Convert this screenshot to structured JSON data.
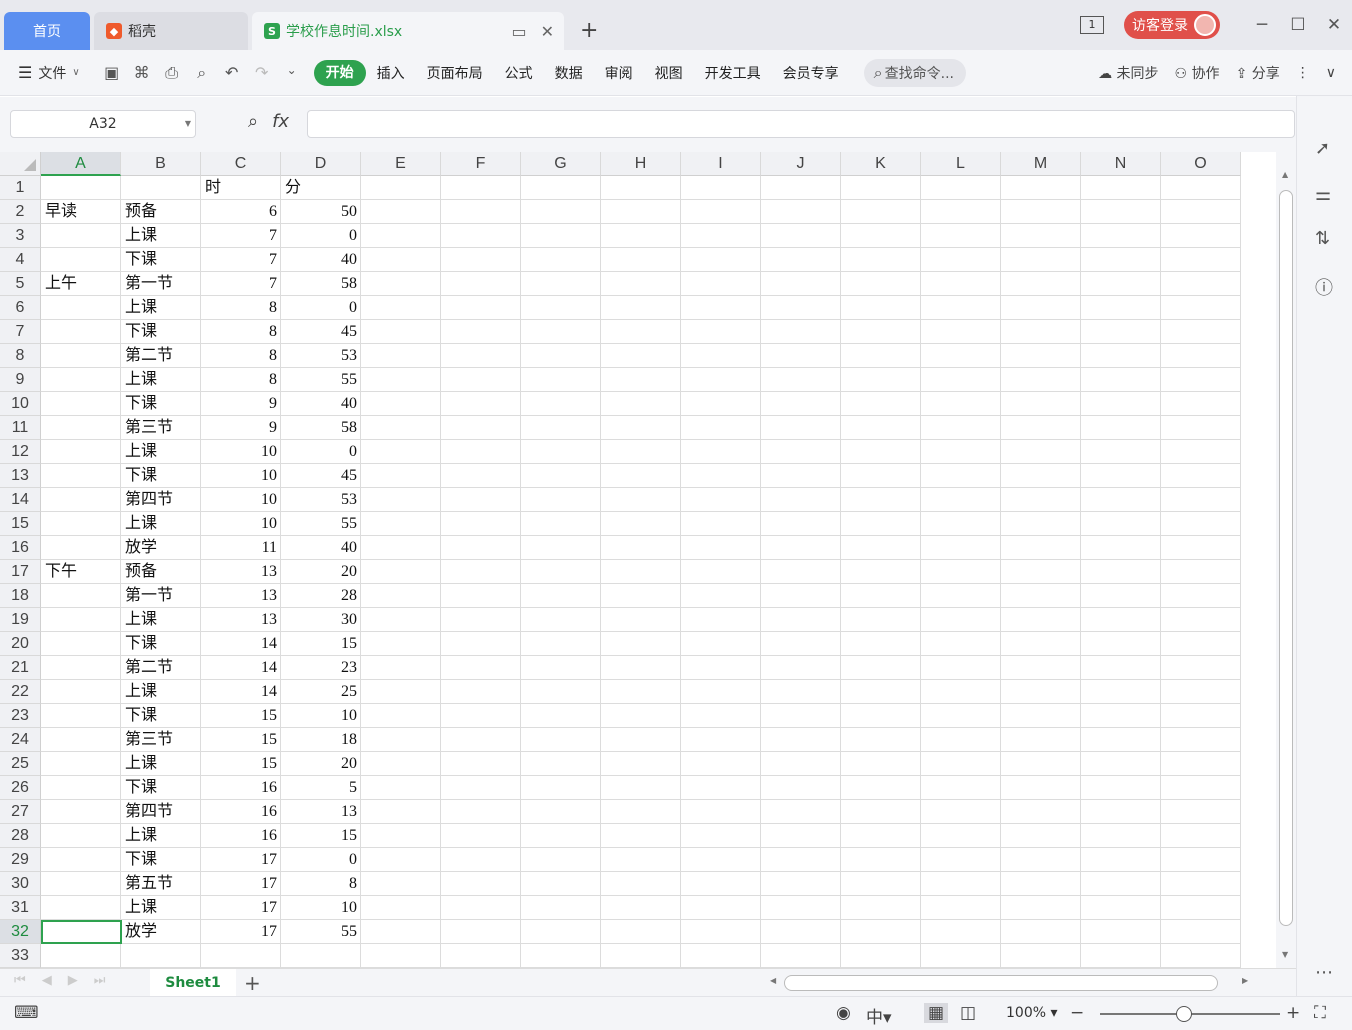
{
  "tabs": {
    "home": "首页",
    "daoke": "稻壳",
    "file": "学校作息时间.xlsx"
  },
  "titlebar": {
    "page_count": "1",
    "login": "访客登录"
  },
  "toolbar": {
    "file_menu": "文件",
    "menus": [
      "开始",
      "插入",
      "页面布局",
      "公式",
      "数据",
      "审阅",
      "视图",
      "开发工具",
      "会员专享"
    ],
    "search_placeholder": "查找命令...",
    "sync": "未同步",
    "collab": "协作",
    "share": "分享"
  },
  "formula": {
    "namebox": "A32",
    "fx": "fx",
    "value": ""
  },
  "columns": [
    "A",
    "B",
    "C",
    "D",
    "E",
    "F",
    "G",
    "H",
    "I",
    "J",
    "K",
    "L",
    "M",
    "N",
    "O"
  ],
  "rows": [
    [
      "",
      "",
      "时",
      "分"
    ],
    [
      "早读",
      "预备",
      "6",
      "50"
    ],
    [
      "",
      "上课",
      "7",
      "0"
    ],
    [
      "",
      "下课",
      "7",
      "40"
    ],
    [
      "上午",
      "第一节",
      "7",
      "58"
    ],
    [
      "",
      "上课",
      "8",
      "0"
    ],
    [
      "",
      "下课",
      "8",
      "45"
    ],
    [
      "",
      "第二节",
      "8",
      "53"
    ],
    [
      "",
      "上课",
      "8",
      "55"
    ],
    [
      "",
      "下课",
      "9",
      "40"
    ],
    [
      "",
      "第三节",
      "9",
      "58"
    ],
    [
      "",
      "上课",
      "10",
      "0"
    ],
    [
      "",
      "下课",
      "10",
      "45"
    ],
    [
      "",
      "第四节",
      "10",
      "53"
    ],
    [
      "",
      "上课",
      "10",
      "55"
    ],
    [
      "",
      "放学",
      "11",
      "40"
    ],
    [
      "下午",
      "预备",
      "13",
      "20"
    ],
    [
      "",
      "第一节",
      "13",
      "28"
    ],
    [
      "",
      "上课",
      "13",
      "30"
    ],
    [
      "",
      "下课",
      "14",
      "15"
    ],
    [
      "",
      "第二节",
      "14",
      "23"
    ],
    [
      "",
      "上课",
      "14",
      "25"
    ],
    [
      "",
      "下课",
      "15",
      "10"
    ],
    [
      "",
      "第三节",
      "15",
      "18"
    ],
    [
      "",
      "上课",
      "15",
      "20"
    ],
    [
      "",
      "下课",
      "16",
      "5"
    ],
    [
      "",
      "第四节",
      "16",
      "13"
    ],
    [
      "",
      "上课",
      "16",
      "15"
    ],
    [
      "",
      "下课",
      "17",
      "0"
    ],
    [
      "",
      "第五节",
      "17",
      "8"
    ],
    [
      "",
      "上课",
      "17",
      "10"
    ],
    [
      "",
      "放学",
      "17",
      "55"
    ],
    [
      "",
      "",
      "",
      ""
    ]
  ],
  "selected": {
    "col": "A",
    "row": 32
  },
  "sheet": {
    "name": "Sheet1"
  },
  "status": {
    "zoom": "100%"
  },
  "colors": {
    "accent": "#2ea24f",
    "home_tab": "#5b8ff0",
    "login": "#e0504a"
  }
}
